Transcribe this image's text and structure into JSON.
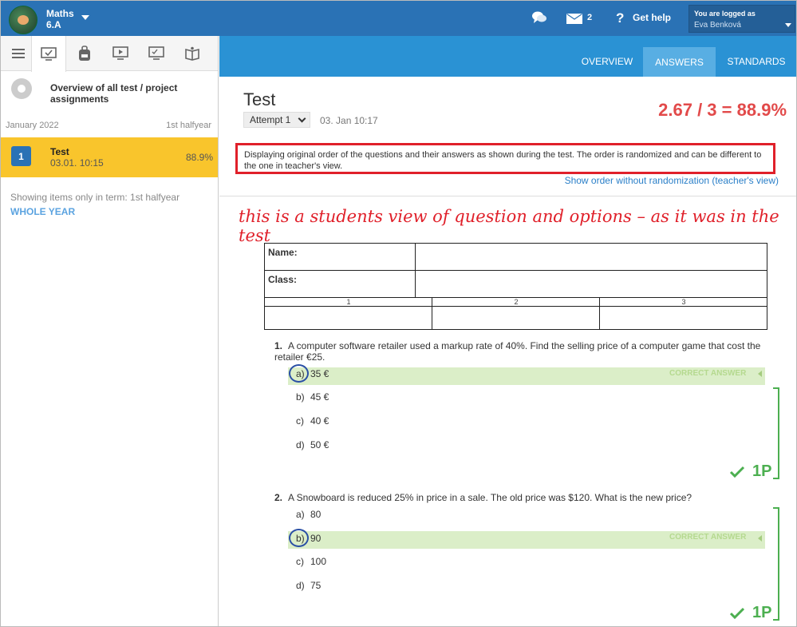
{
  "topbar": {
    "course_name": "Maths",
    "course_class": "6.A",
    "mail_count": "2",
    "help_label": "Get help",
    "login_line1": "You are logged as",
    "login_name": "Eva Benková"
  },
  "sidebar": {
    "overview_label": "Overview of all test / project assignments",
    "term_month": "January 2022",
    "term_half": "1st halfyear",
    "item": {
      "number": "1",
      "title": "Test",
      "date": "03.01. 10:15",
      "percent": "88.9%"
    },
    "showing_text": "Showing items only in term: 1st halfyear",
    "whole_year": "WHOLE YEAR"
  },
  "tabs": [
    {
      "label": "OVERVIEW",
      "active": false
    },
    {
      "label": "ANSWERS",
      "active": true
    },
    {
      "label": "STANDARDS",
      "active": false
    }
  ],
  "test": {
    "title": "Test",
    "attempt": "Attempt 1",
    "date": "03. Jan 10:17",
    "score": "2.67 / 3 = 88.9%",
    "notice": "Displaying original order of the questions and their answers as shown during the test. The order is randomized and can be different to the one in teacher's view.",
    "show_order_link": "Show order without randomization (teacher's view)",
    "annotation": "this is a students view of question and options – as it was in the test"
  },
  "name_table": {
    "name_label": "Name:",
    "class_label": "Class:",
    "columns": [
      "1",
      "2",
      "3"
    ]
  },
  "questions": [
    {
      "number": "1.",
      "text": "A computer software retailer used a markup rate of 40%. Find the selling price of a computer game that cost the retailer €25.",
      "options": [
        {
          "letter": "a)",
          "text": "35 €",
          "correct": true,
          "selected": true
        },
        {
          "letter": "b)",
          "text": "45 €",
          "correct": false,
          "selected": false
        },
        {
          "letter": "c)",
          "text": "40 €",
          "correct": false,
          "selected": false
        },
        {
          "letter": "d)",
          "text": "50 €",
          "correct": false,
          "selected": false
        }
      ],
      "correct_label": "CORRECT ANSWER",
      "points": "1P"
    },
    {
      "number": "2.",
      "text": "A Snowboard is reduced 25% in price in a sale. The old price was $120. What is the new price?",
      "options": [
        {
          "letter": "a)",
          "text": "80",
          "correct": false,
          "selected": false
        },
        {
          "letter": "b)",
          "text": "90",
          "correct": true,
          "selected": true
        },
        {
          "letter": "c)",
          "text": "100",
          "correct": false,
          "selected": false
        },
        {
          "letter": "d)",
          "text": "75",
          "correct": false,
          "selected": false
        }
      ],
      "correct_label": "CORRECT ANSWER",
      "points": "1P"
    }
  ],
  "colors": {
    "topbar": "#2a72b5",
    "mainbar": "#2a92d4",
    "active_item": "#f9c52c",
    "score": "#e24a4a",
    "correct_bg": "#dbeec8",
    "points_green": "#4caf50"
  }
}
